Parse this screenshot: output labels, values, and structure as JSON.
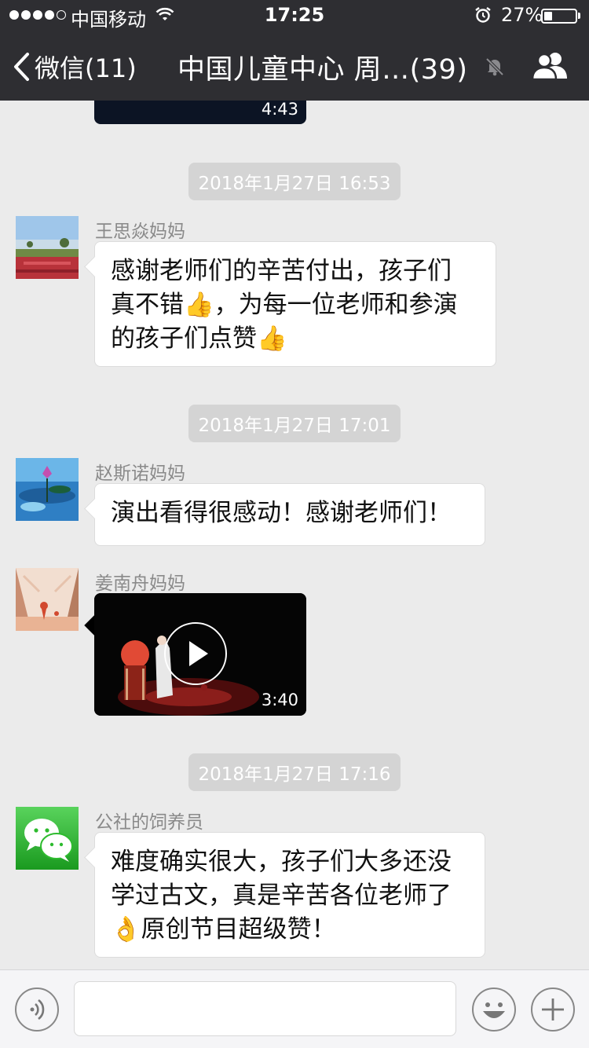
{
  "status_bar": {
    "carrier": "中国移动",
    "time": "17:25",
    "battery_pct": "27%",
    "battery_level": 0.27
  },
  "nav": {
    "back_label": "微信(11)",
    "title": "中国儿童中心 周…(39)"
  },
  "chat": {
    "top_video_duration": "4:43",
    "timestamps": [
      "2018年1月27日 16:53",
      "2018年1月27日 17:01",
      "2018年1月27日 17:16"
    ],
    "messages": [
      {
        "sender": "王思焱妈妈",
        "lines": [
          "感谢老师们的辛苦付出，孩子们",
          "真不错👍，为每一位老师和参演",
          "的孩子们点赞👍"
        ]
      },
      {
        "sender": "赵斯诺妈妈",
        "lines": [
          "演出看得很感动！感谢老师们！"
        ]
      },
      {
        "sender": "姜南舟妈妈",
        "video_duration": "3:40"
      },
      {
        "sender": "公社的饲养员",
        "lines": [
          "难度确实很大，孩子们大多还没",
          "学过古文，真是辛苦各位老师了",
          "👌原创节目超级赞！"
        ]
      }
    ]
  },
  "input_bar": {
    "value": ""
  },
  "icons": {
    "back": "chevron-left-icon",
    "mute": "bell-muted-icon",
    "members": "group-members-icon",
    "voice": "voice-icon",
    "emoji": "smiley-icon",
    "plus": "plus-icon",
    "wifi": "wifi-icon",
    "alarm": "alarm-icon"
  },
  "colors": {
    "nav_bg": "#2e2e32",
    "chat_bg": "#ebebeb",
    "timestamp_bg": "#d4d4d4",
    "bubble_bg": "#ffffff",
    "wechat_green": "#2dbb2e"
  }
}
